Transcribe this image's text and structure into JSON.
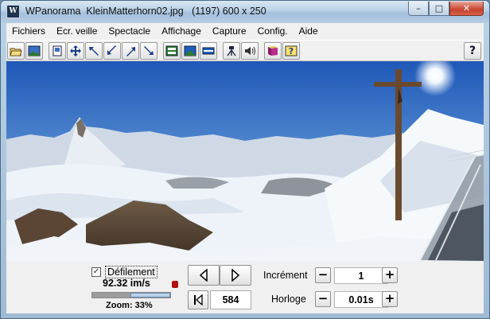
{
  "window": {
    "app_icon": "W",
    "title": "WPanorama  KleinMatterhorn02.jpg   (1197) 600 x 250",
    "minimize_label": "–",
    "maximize_label": "□",
    "close_label": "✕"
  },
  "menu": {
    "items": [
      "Fichiers",
      "Ecr. veille",
      "Spectacle",
      "Affichage",
      "Capture",
      "Config.",
      "Aide"
    ]
  },
  "toolbar": {
    "icons": [
      "open-file-icon",
      "image-icon",
      "page-setup-icon",
      "move-icon",
      "scroll-up-left-icon",
      "scroll-down-left-icon",
      "scroll-up-right-icon",
      "scroll-down-right-icon",
      "fit-window-icon",
      "fit-height-icon",
      "fit-width-icon",
      "tripod-icon",
      "sound-icon",
      "book-icon",
      "help-context-icon"
    ],
    "help_label": "?"
  },
  "controls": {
    "scroll_checked": true,
    "check_mark": "✓",
    "scroll_label": "Défilement",
    "speed": "92.32 im/s",
    "zoom_level": 0.33,
    "zoom_label": "Zoom: 33%",
    "position": "584",
    "increment_label": "Incrément",
    "increment_value": "1",
    "clock_label": "Horloge",
    "clock_value": "0.01s",
    "minus": "−",
    "plus": "+"
  },
  "colors": {
    "sky_top": "#1e5dbf",
    "sky_horizon": "#a9c8e8",
    "snow": "#f4f7fb",
    "rock": "#5b4a3a"
  }
}
